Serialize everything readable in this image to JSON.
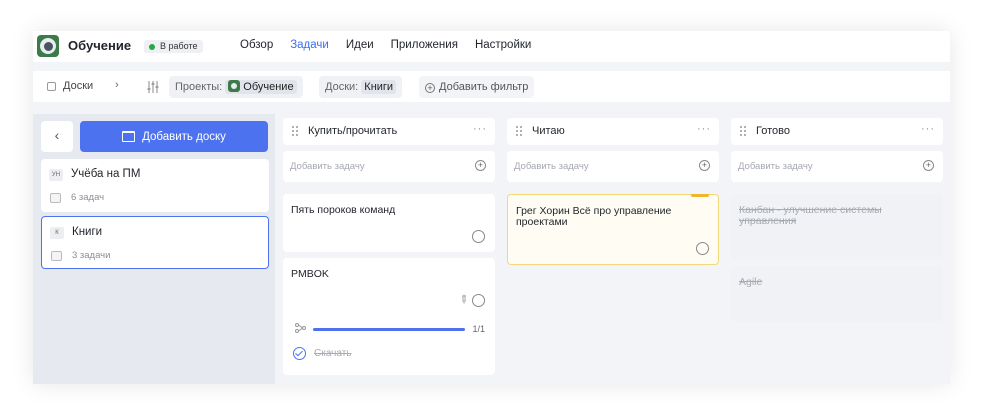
{
  "header": {
    "project_title": "Обучение",
    "status": "В работе",
    "nav": [
      {
        "label": "Обзор",
        "active": false
      },
      {
        "label": "Задачи",
        "active": true
      },
      {
        "label": "Идеи",
        "active": false
      },
      {
        "label": "Приложения",
        "active": false
      },
      {
        "label": "Настройки",
        "active": false
      }
    ]
  },
  "filterbar": {
    "boards_button": "Доски",
    "project_filter": {
      "label": "Проекты:",
      "value": "Обучение"
    },
    "boards_filter": {
      "label": "Доски:",
      "value": "Книги"
    },
    "add_filter": "Добавить фильтр"
  },
  "leftpanel": {
    "add_board": "Добавить доску",
    "boards": [
      {
        "initials": "УН",
        "name": "Учёба на ПМ",
        "count": "6 задач",
        "selected": false
      },
      {
        "initials": "К",
        "name": "Книги",
        "count": "3 задачи",
        "selected": true
      }
    ]
  },
  "columns": [
    {
      "title": "Купить/прочитать",
      "add_placeholder": "Добавить задачу",
      "tasks": [
        {
          "title": "Пять пороков команд"
        },
        {
          "title": "PMBOK",
          "progress_text": "1/1",
          "progress": 1.0,
          "subtask": "Скачать"
        }
      ]
    },
    {
      "title": "Читаю",
      "add_placeholder": "Добавить задачу",
      "tasks": [
        {
          "title": "Грег Хорин Всё про управление проектами"
        }
      ]
    },
    {
      "title": "Готово",
      "add_placeholder": "Добавить задачу",
      "tasks": [
        {
          "title": "Канбан - улучшение системы управления"
        },
        {
          "title": "Agile"
        }
      ]
    }
  ],
  "colors": {
    "accent": "#4c72f0",
    "status_dot": "#27a845",
    "highlight_flag": "#f0b429"
  }
}
